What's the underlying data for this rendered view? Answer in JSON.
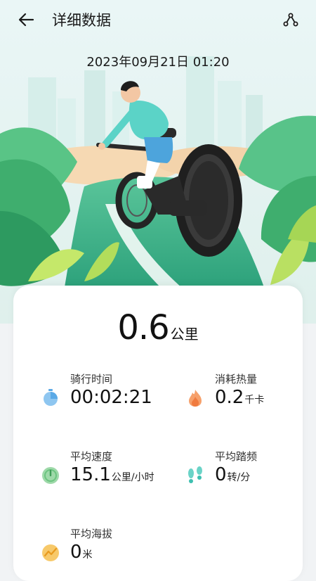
{
  "header": {
    "title": "详细数据",
    "back_icon": "back-arrow-icon",
    "share_icon": "share-icon"
  },
  "record": {
    "datetime": "2023年09月21日 01:20"
  },
  "summary": {
    "distance_value": "0.6",
    "distance_unit": "公里"
  },
  "metrics": [
    {
      "label": "骑行时间",
      "value": "00:02:21",
      "unit": "",
      "icon": "stopwatch-icon",
      "color": "#5aa9e6"
    },
    {
      "label": "消耗热量",
      "value": "0.2",
      "unit": "千卡",
      "icon": "flame-icon",
      "color": "#f07b3f"
    },
    {
      "label": "平均速度",
      "value": "15.1",
      "unit": "公里/小时",
      "icon": "speedometer-icon",
      "color": "#6cc480"
    },
    {
      "label": "平均踏频",
      "value": "0",
      "unit": "转/分",
      "icon": "footprints-icon",
      "color": "#3dbfb0"
    },
    {
      "label": "平均海拔",
      "value": "0",
      "unit": "米",
      "icon": "altitude-icon",
      "color": "#f5b73b"
    }
  ],
  "colors": {
    "background": "#f1f3f5",
    "card": "#ffffff",
    "hero_green": "#2fae7a",
    "road": "#36b88d",
    "sky": "#e6f5f6"
  }
}
